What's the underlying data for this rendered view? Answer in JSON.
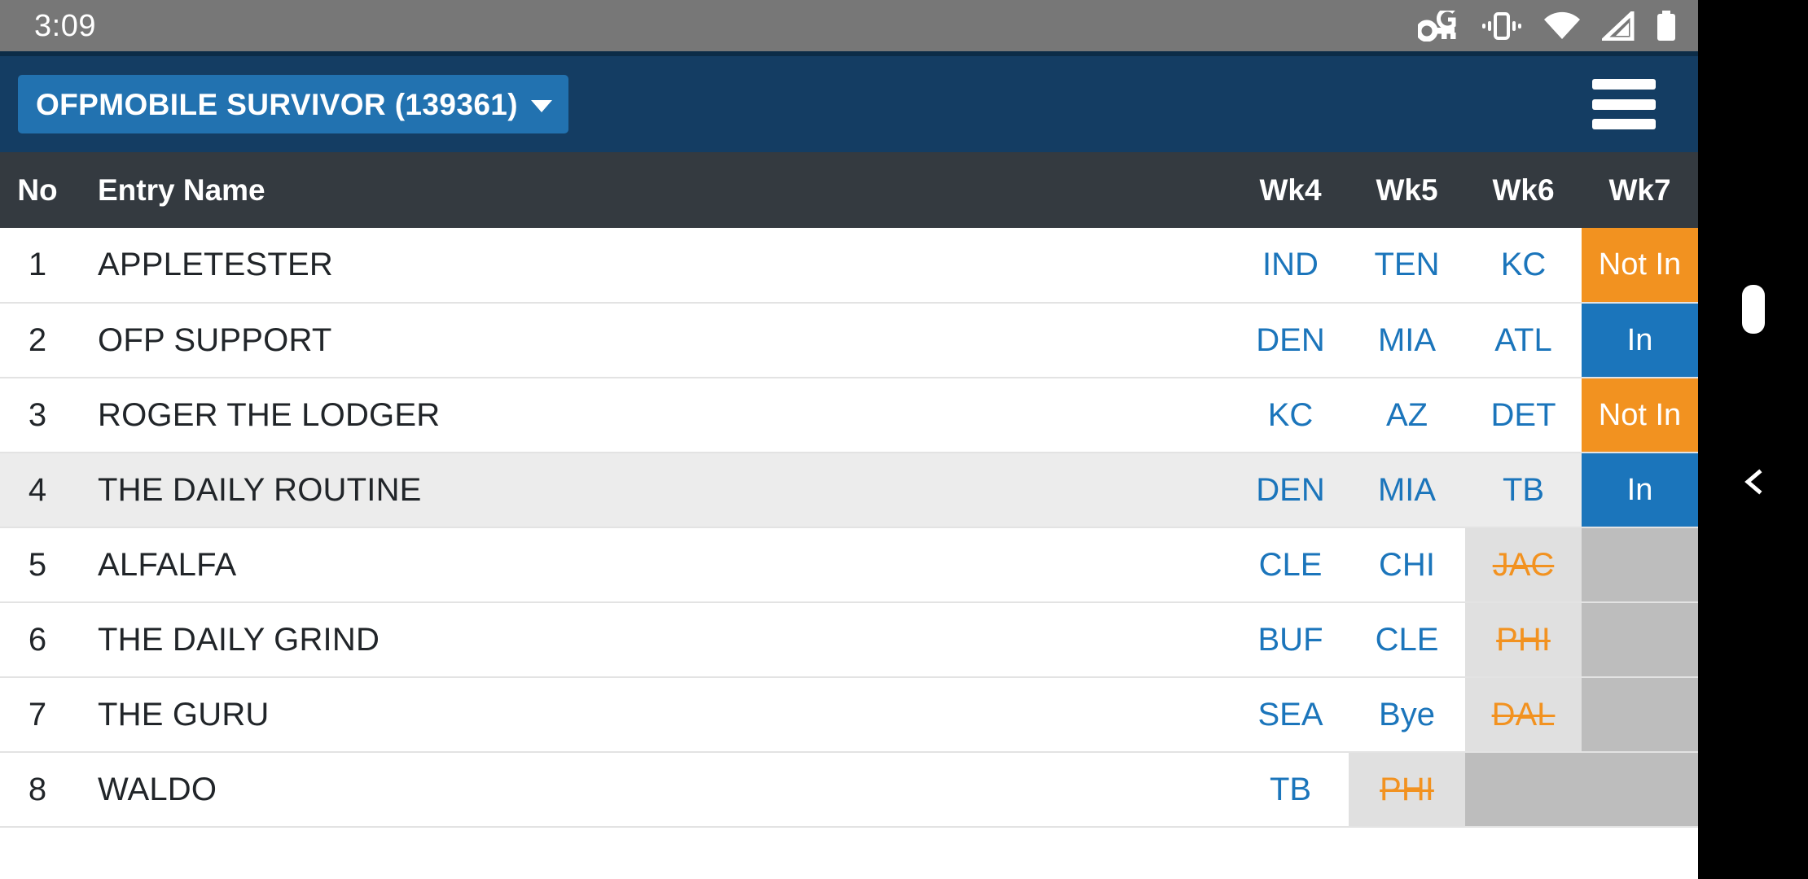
{
  "statusbar": {
    "clock": "3:09",
    "icons": [
      {
        "name": "google-password-key-icon"
      },
      {
        "name": "vibrate-mode-icon"
      },
      {
        "name": "wifi-icon"
      },
      {
        "name": "cellular-signal-icon"
      },
      {
        "name": "battery-icon"
      }
    ]
  },
  "appbar": {
    "title": "OFPMOBILE SURVIVOR (139361)",
    "dropdown_icon": "chevron-down-icon",
    "menu_icon": "hamburger-menu-icon"
  },
  "table": {
    "columns": {
      "no": "No",
      "name": "Entry Name",
      "weeks": [
        "Wk4",
        "Wk5",
        "Wk6",
        "Wk7"
      ]
    },
    "rows": [
      {
        "no": "1",
        "name": "APPLETESTER",
        "wk4": "IND",
        "wk5": "TEN",
        "wk6": "KC",
        "wk7": "Not In"
      },
      {
        "no": "2",
        "name": "OFP SUPPORT",
        "wk4": "DEN",
        "wk5": "MIA",
        "wk6": "ATL",
        "wk7": "In"
      },
      {
        "no": "3",
        "name": "ROGER THE LODGER",
        "wk4": "KC",
        "wk5": "AZ",
        "wk6": "DET",
        "wk7": "Not In"
      },
      {
        "no": "4",
        "name": "THE DAILY ROUTINE",
        "wk4": "DEN",
        "wk5": "MIA",
        "wk6": "TB",
        "wk7": "In"
      },
      {
        "no": "5",
        "name": "ALFALFA",
        "wk4": "CLE",
        "wk5": "CHI",
        "wk6": "JAC",
        "wk7": ""
      },
      {
        "no": "6",
        "name": "THE DAILY GRIND",
        "wk4": "BUF",
        "wk5": "CLE",
        "wk6": "PHI",
        "wk7": ""
      },
      {
        "no": "7",
        "name": "THE GURU",
        "wk4": "SEA",
        "wk5": "Bye",
        "wk6": "DAL",
        "wk7": ""
      },
      {
        "no": "8",
        "name": "WALDO",
        "wk4": "TB",
        "wk5": "PHI",
        "wk6": "",
        "wk7": ""
      }
    ]
  },
  "sidestrip": {
    "handle_icon": "drag-handle-pill",
    "back_icon": "back-chevron-icon"
  },
  "colors": {
    "appbar": "#143d63",
    "title_chip": "#2272b0",
    "table_header": "#343a40",
    "pick_blue": "#1b75bb",
    "eliminated_orange": "#f29220",
    "alt_row": "#ececec",
    "eliminated_cell_bg": "#e0e0e0",
    "dead_cell_bg": "#bdbdbd",
    "statusbar": "#777777"
  }
}
